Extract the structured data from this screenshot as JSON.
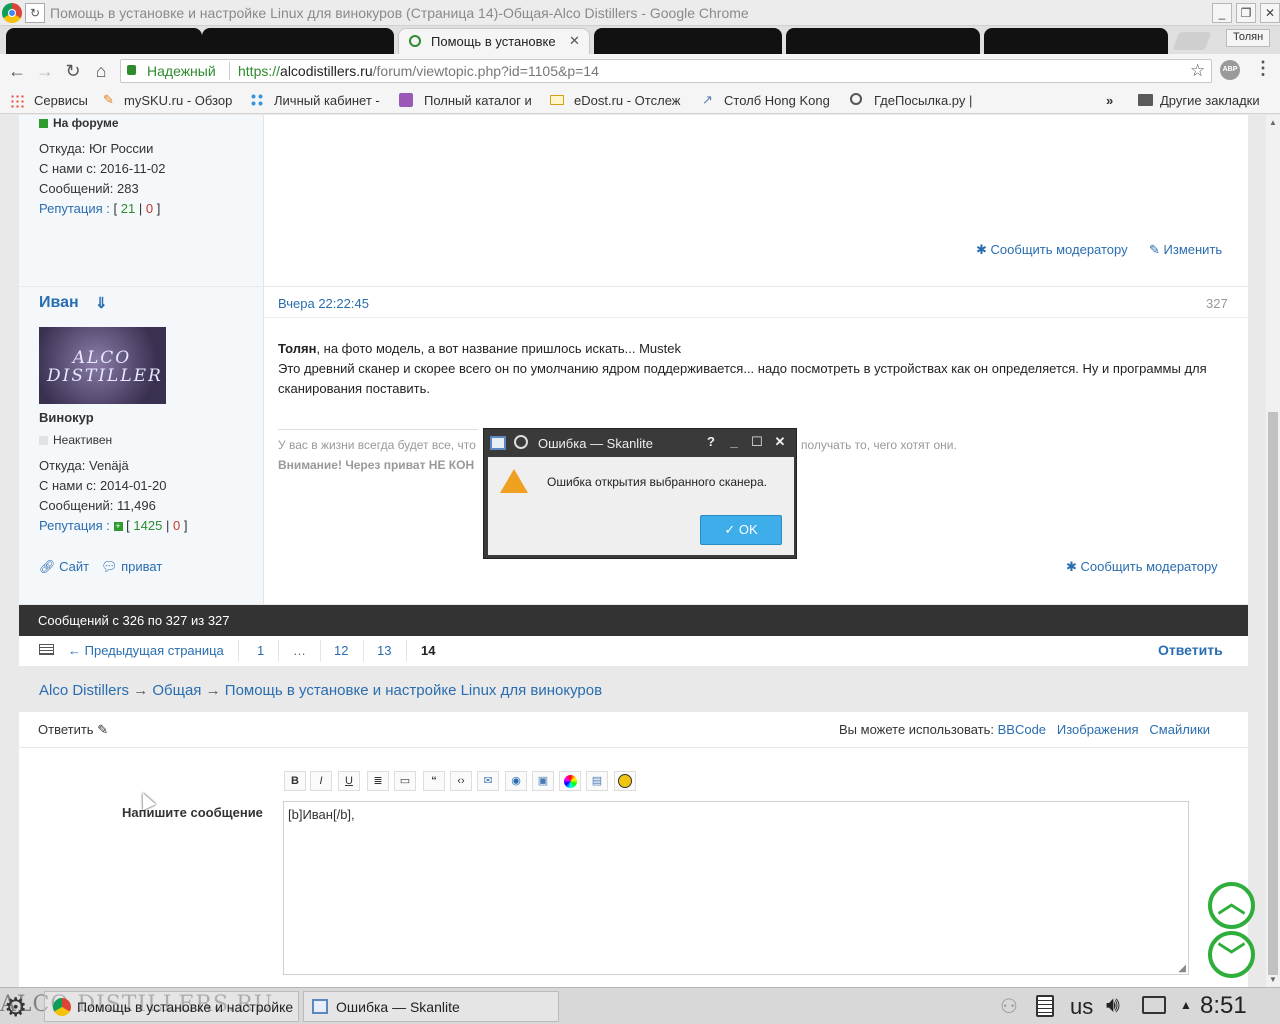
{
  "window": {
    "title": "Помощь в установке и настройке Linux для винокуров (Страница 14)-Общая-Alco Distillers - Google Chrome",
    "user": "Толян"
  },
  "tabs": {
    "active_label": "Помощь в установке"
  },
  "omnibox": {
    "secure_label": "Надежный",
    "url_scheme": "https://",
    "url_host": "alcodistillers.ru",
    "url_path": "/forum/viewtopic.php?id=1105&p=14"
  },
  "bookmarks": {
    "items": [
      "Сервисы",
      "mySKU.ru - Обзор",
      "Личный кабинет -",
      "Полный каталог и",
      "eDost.ru - Отслеж",
      "Столб Hong Kong",
      "ГдеПосылка.ру |"
    ],
    "more": "»",
    "other": "Другие закладки"
  },
  "post1": {
    "status": "На форуме",
    "from": "Откуда: Юг России",
    "since": "С нами с: 2016-11-02",
    "messages": "Сообщений: 283",
    "rep_label": "Репутация :",
    "rep_open": "[",
    "rep_pos": "21",
    "rep_sep": "|",
    "rep_neg": "0",
    "rep_close": "]",
    "report": "Сообщить модератору",
    "edit": "Изменить"
  },
  "post2": {
    "author": "Иван",
    "author_arrow": "⇓",
    "avatar_text": "ALCO DISTILLER",
    "rank": "Винокур",
    "status": "Неактивен",
    "from": "Откуда: Venäjä",
    "since": "С нами с: 2014-01-20",
    "messages": "Сообщений: 11,496",
    "rep_label": "Репутация :",
    "rep_open": "[",
    "rep_pos": "1425",
    "rep_sep": "|",
    "rep_neg": "0",
    "rep_close": "]",
    "site": "Сайт",
    "pm": "приват",
    "date": "Вчера 22:22:45",
    "number": "327",
    "addressee": "Толян",
    "line1": ", на фото модель, а вот название пришлось искать... Mustek",
    "line2": "Это древний сканер и скорее всего он по умолчанию ядром поддерживается... надо посмотреть в устройствах как он определяется. Ну и программы для сканирования поставить.",
    "sig1_left": "У вас в жизни всегда будет все, что",
    "sig1_right": "получать то, чего хотят они.",
    "sig2": "Внимание! Через приват НЕ КОН",
    "report": "Сообщить модератору"
  },
  "pager": {
    "summary": "Сообщений с 326 по 327 из 327",
    "prev": "Предыдущая страница",
    "pages": [
      "1",
      "…",
      "12",
      "13",
      "14"
    ],
    "reply": "Ответить"
  },
  "breadcrumb": {
    "items": [
      "Alco Distillers",
      "Общая",
      "Помощь в установке и настройке Linux для винокуров"
    ],
    "sep": "→"
  },
  "reply_form": {
    "title": "Ответить",
    "use_label": "Вы можете использовать:",
    "links": [
      "BBCode",
      "Изображения",
      "Смайлики"
    ],
    "field_label": "Напишите сообщение",
    "text": "[b]Иван[/b],"
  },
  "toolbar_buttons": [
    "bold",
    "italic",
    "underline",
    "list",
    "list-ordered",
    "quote",
    "code",
    "email",
    "link",
    "image",
    "color",
    "spoiler",
    "smiley"
  ],
  "dialog": {
    "title": "Ошибка — Skanlite",
    "message": "Ошибка открытия выбранного сканера.",
    "ok": "OK"
  },
  "taskbar": {
    "brand": "ALCO DISTILLERS.RU",
    "task1": "Помощь в установке и настройке",
    "task2": "Ошибка — Skanlite",
    "layout": "us",
    "time": "8:51"
  }
}
